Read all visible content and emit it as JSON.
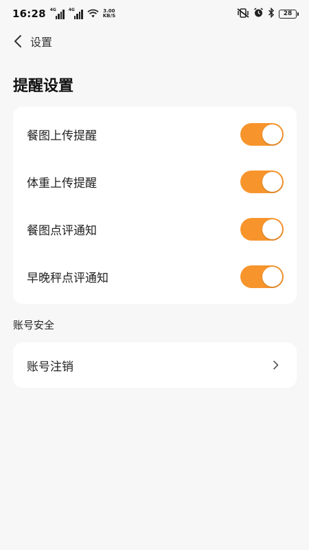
{
  "status_bar": {
    "time": "16:28",
    "network_1": "4G",
    "network_2": "4G",
    "speed_value": "3.00",
    "speed_unit": "KB/S",
    "battery": "28"
  },
  "nav": {
    "title": "设置"
  },
  "reminders": {
    "title": "提醒设置",
    "items": [
      {
        "label": "餐图上传提醒",
        "enabled": true
      },
      {
        "label": "体重上传提醒",
        "enabled": true
      },
      {
        "label": "餐图点评通知",
        "enabled": true
      },
      {
        "label": "早晚秤点评通知",
        "enabled": true
      }
    ]
  },
  "account": {
    "section_label": "账号安全",
    "deactivate_label": "账号注销"
  },
  "colors": {
    "accent": "#f7952c",
    "background": "#f7f7f7",
    "card": "#ffffff"
  }
}
